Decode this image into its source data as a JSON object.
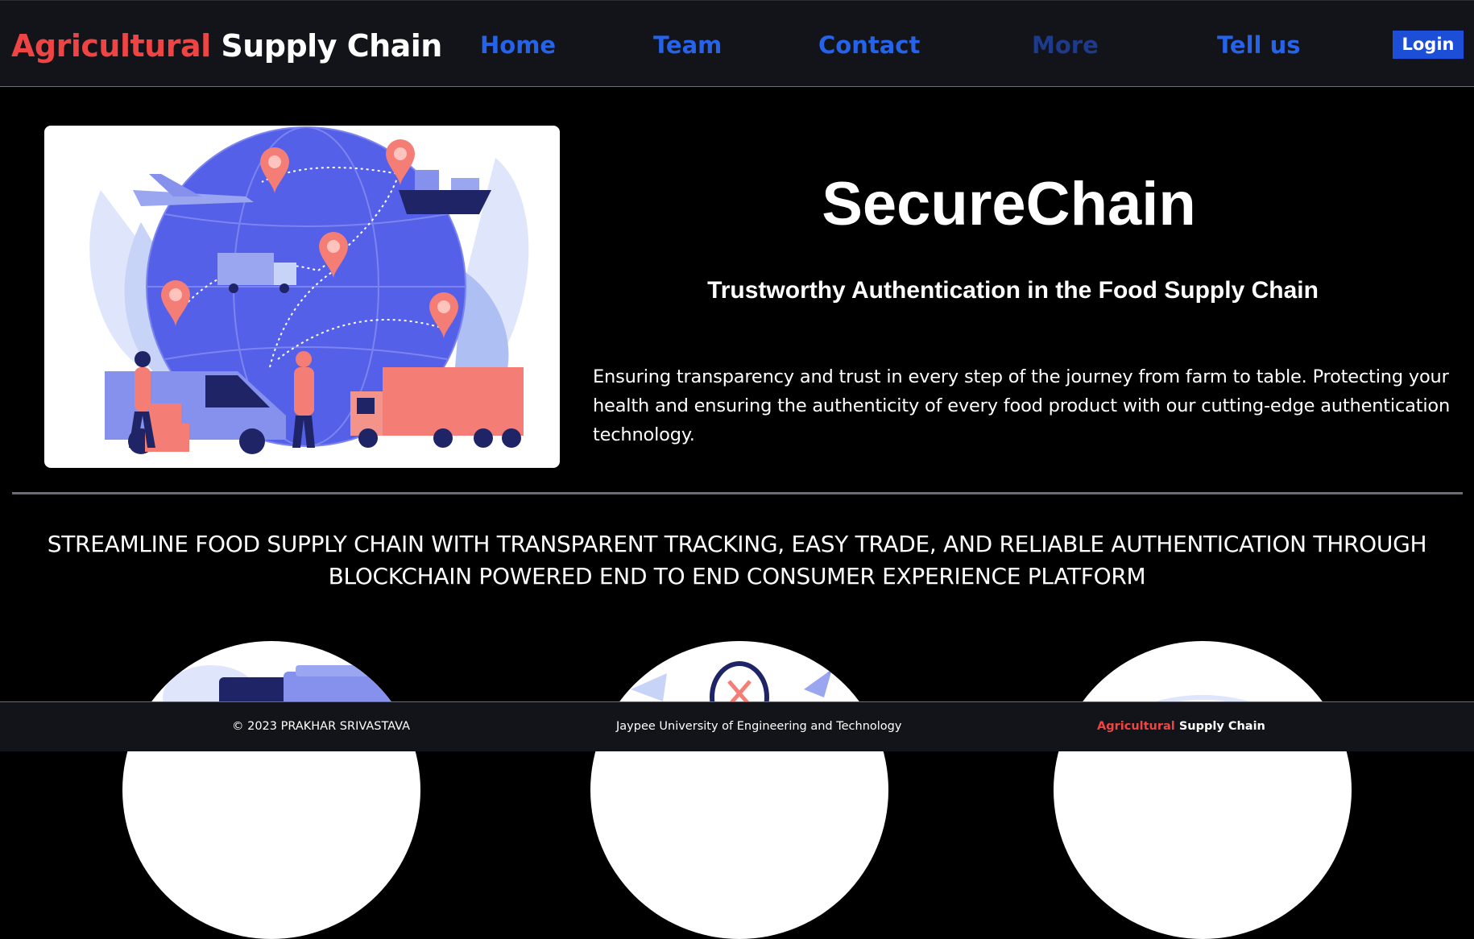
{
  "header": {
    "brand_part1": "Agricultural",
    "brand_part2": "Supply Chain",
    "nav": {
      "home": "Home",
      "team": "Team",
      "contact": "Contact",
      "more": "More",
      "tell_us": "Tell us"
    },
    "login_label": "Login"
  },
  "hero": {
    "title": "SecureChain",
    "subtitle": "Trustworthy Authentication in the Food Supply Chain",
    "description": "Ensuring transparency and trust in every step of the journey from farm to table. Protecting your health and ensuring the authenticity of every food product with our cutting-edge authentication technology.",
    "illustration_icon": "global-logistics-illustration"
  },
  "tagline": "STREAMLINE FOOD SUPPLY CHAIN WITH TRANSPARENT TRACKING, EASY TRADE, AND RELIABLE AUTHENTICATION THROUGH BLOCKCHAIN POWERED END TO END CONSUMER EXPERIENCE PLATFORM",
  "features": [
    {
      "icon": "tracking-illustration"
    },
    {
      "icon": "trade-illustration"
    },
    {
      "icon": "authentication-illustration"
    }
  ],
  "footer": {
    "copyright": "© 2023 PRAKHAR SRIVASTAVA",
    "university": "Jaypee University of Engineering and Technology",
    "brand_part1": "Agricultural",
    "brand_part2": "Supply Chain"
  },
  "colors": {
    "accent_red": "#ef4444",
    "nav_blue": "#2563eb",
    "nav_more": "#1e3a8a",
    "login_bg": "#1d4ed8",
    "header_bg": "#131419",
    "page_bg": "#000000"
  }
}
